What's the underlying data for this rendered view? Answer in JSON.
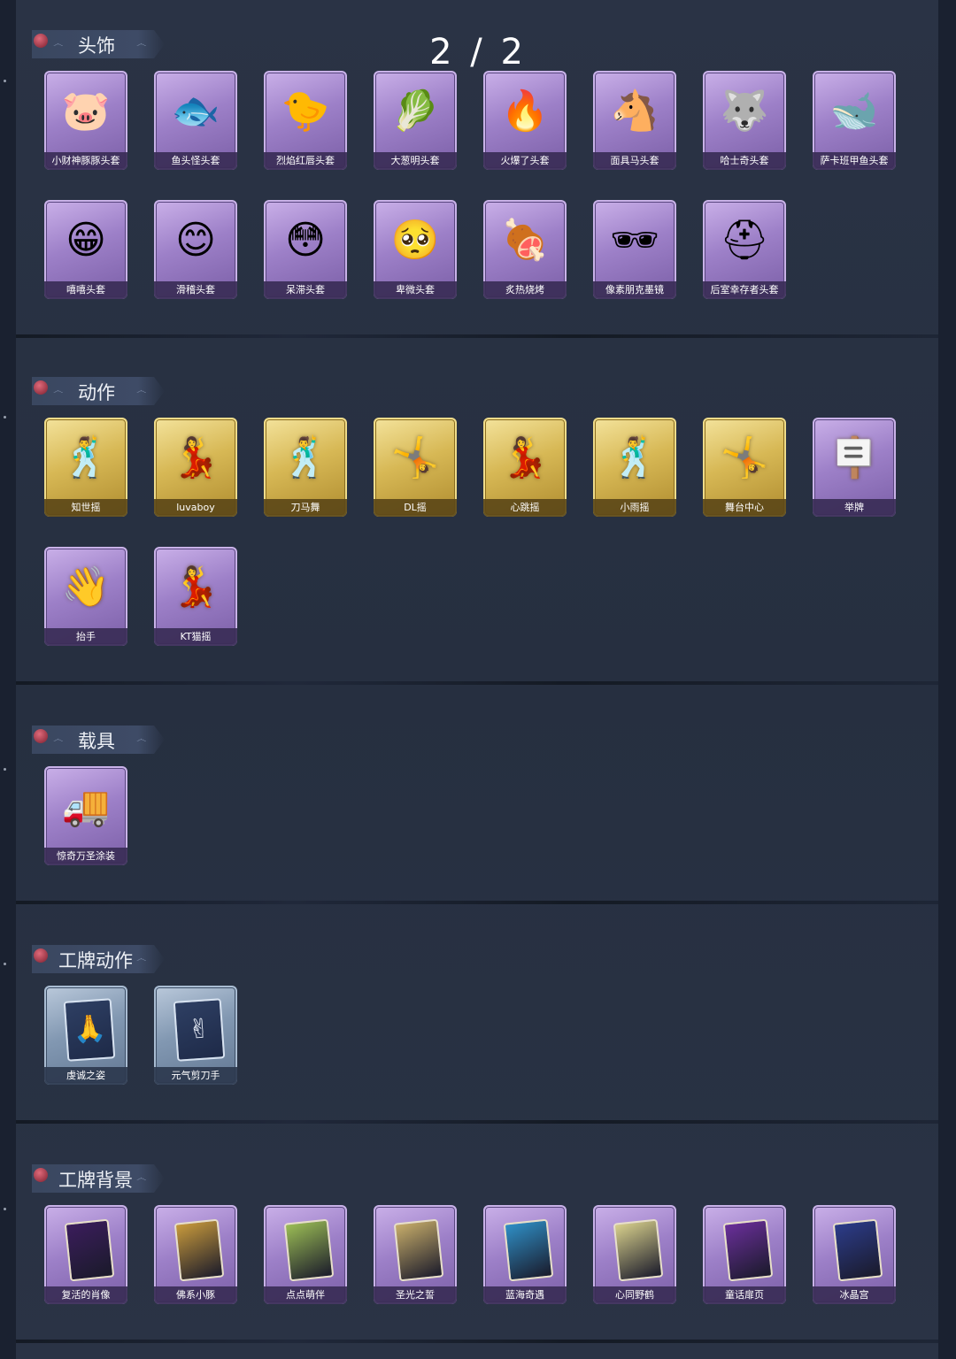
{
  "page_indicator": "2 / 2",
  "sections": {
    "headwear": {
      "title": "头饰",
      "items": [
        {
          "label": "小财神豚豚头套",
          "icon": "pig-head-icon",
          "glyph": "🐷"
        },
        {
          "label": "鱼头怪头套",
          "icon": "fish-monster-head-icon",
          "glyph": "🐟"
        },
        {
          "label": "烈焰红唇头套",
          "icon": "yellow-mascot-head-icon",
          "glyph": "🐤"
        },
        {
          "label": "大葱明头套",
          "icon": "scallion-head-icon",
          "glyph": "🥬"
        },
        {
          "label": "火爆了头套",
          "icon": "fire-head-icon",
          "glyph": "🔥"
        },
        {
          "label": "面具马头套",
          "icon": "horse-head-icon",
          "glyph": "🐴"
        },
        {
          "label": "哈士奇头套",
          "icon": "husky-head-icon",
          "glyph": "🐺"
        },
        {
          "label": "萨卡班甲鱼头套",
          "icon": "fish-head-icon",
          "glyph": "🐋"
        },
        {
          "label": "嘻嘻头套",
          "icon": "grin-emoji-icon",
          "glyph": "😁"
        },
        {
          "label": "滑稽头套",
          "icon": "funny-emoji-icon",
          "glyph": "😊"
        },
        {
          "label": "呆滞头套",
          "icon": "dazed-emoji-icon",
          "glyph": "😳"
        },
        {
          "label": "卑微头套",
          "icon": "humble-emoji-icon",
          "glyph": "🥺"
        },
        {
          "label": "炙热烧烤",
          "icon": "meat-head-icon",
          "glyph": "🍖"
        },
        {
          "label": "像素朋克墨镜",
          "icon": "pixel-sunglasses-icon",
          "glyph": "🕶"
        },
        {
          "label": "后室幸存者头套",
          "icon": "gas-mask-helmet-icon",
          "glyph": "⛑"
        }
      ]
    },
    "emotes": {
      "title": "动作",
      "items": [
        {
          "label": "知世摇",
          "icon": "dance-figure-icon",
          "glyph": "🕺",
          "rarity": "gold"
        },
        {
          "label": "luvaboy",
          "icon": "dance-figure-icon",
          "glyph": "💃",
          "rarity": "gold"
        },
        {
          "label": "刀马舞",
          "icon": "dance-figure-icon",
          "glyph": "🕺",
          "rarity": "gold"
        },
        {
          "label": "DL摇",
          "icon": "dance-figure-icon",
          "glyph": "🤸",
          "rarity": "gold"
        },
        {
          "label": "心跳摇",
          "icon": "dance-figure-icon",
          "glyph": "💃",
          "rarity": "gold"
        },
        {
          "label": "小雨摇",
          "icon": "dance-figure-icon",
          "glyph": "🕺",
          "rarity": "gold"
        },
        {
          "label": "舞台中心",
          "icon": "dance-figure-icon",
          "glyph": "🤸",
          "rarity": "gold"
        },
        {
          "label": "举牌",
          "icon": "sign-holding-figure-icon",
          "glyph": "🪧",
          "rarity": "purple"
        },
        {
          "label": "抬手",
          "icon": "hand-raise-figure-icon",
          "glyph": "👋",
          "rarity": "purple"
        },
        {
          "label": "KT猫摇",
          "icon": "dance-figure-icon",
          "glyph": "💃",
          "rarity": "purple"
        }
      ]
    },
    "vehicles": {
      "title": "载具",
      "items": [
        {
          "label": "惊奇万圣涂装",
          "icon": "truck-icon",
          "glyph": "🚚"
        }
      ]
    },
    "badge_actions": {
      "title": "工牌动作",
      "items": [
        {
          "label": "虔诚之姿",
          "icon": "badge-pose-icon",
          "glyph": "🙏"
        },
        {
          "label": "元气剪刀手",
          "icon": "badge-pose-icon",
          "glyph": "✌"
        }
      ]
    },
    "badge_backgrounds": {
      "title": "工牌背景",
      "items": [
        {
          "label": "复活的肖像",
          "icon": "portrait-card-icon",
          "art": "#3b1d5c"
        },
        {
          "label": "佛系小豚",
          "icon": "pig-card-icon",
          "art": "#c89a3c"
        },
        {
          "label": "点点萌伴",
          "icon": "meadow-card-icon",
          "art": "#9bbd55"
        },
        {
          "label": "圣光之誓",
          "icon": "holy-light-card-icon",
          "art": "#c7ad6a"
        },
        {
          "label": "蓝海奇遇",
          "icon": "ocean-card-icon",
          "art": "#2f8fc6"
        },
        {
          "label": "心同野鹤",
          "icon": "crane-card-icon",
          "art": "#d8d08c"
        },
        {
          "label": "童话扉页",
          "icon": "curtain-card-icon",
          "art": "#6a2f9a"
        },
        {
          "label": "冰晶宫",
          "icon": "ice-palace-card-icon",
          "art": "#2c3c8a"
        }
      ]
    }
  }
}
